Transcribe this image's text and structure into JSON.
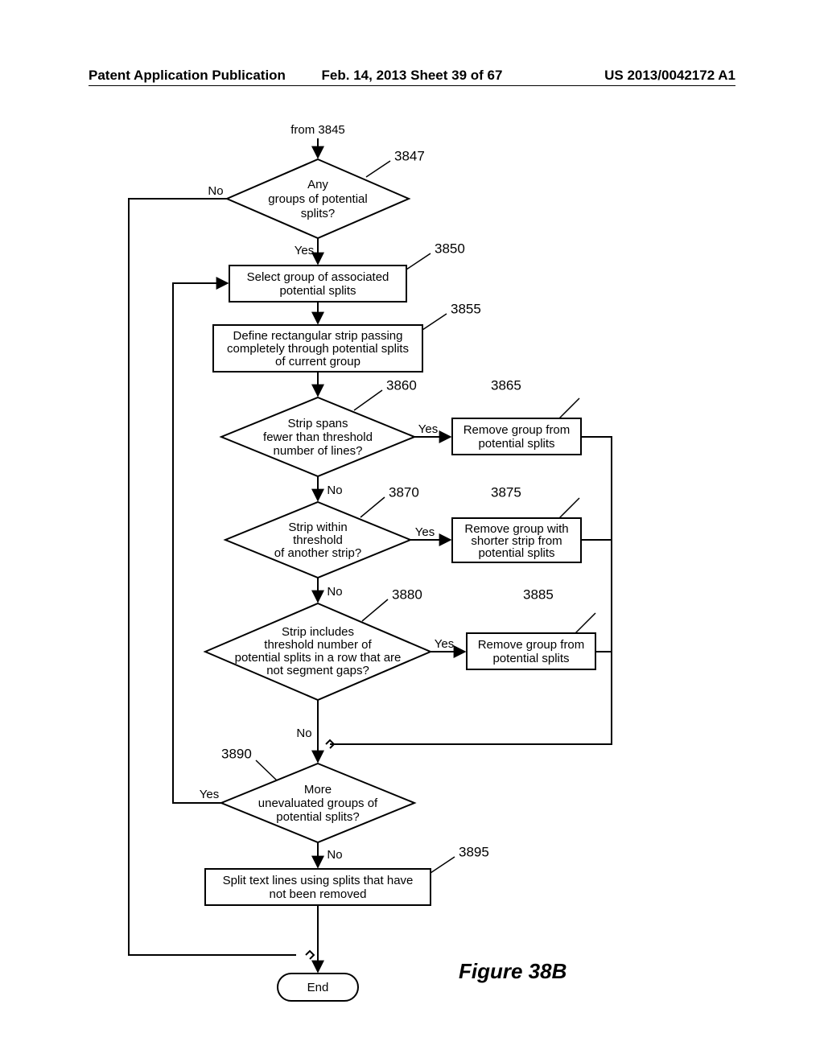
{
  "header": {
    "left": "Patent Application Publication",
    "center": "Feb. 14, 2013  Sheet 39 of 67",
    "right": "US 2013/0042172 A1"
  },
  "figure_title": "Figure 38B",
  "from_label": "from 3845",
  "refs": {
    "r3847": "3847",
    "r3850": "3850",
    "r3855": "3855",
    "r3860": "3860",
    "r3865": "3865",
    "r3870": "3870",
    "r3875": "3875",
    "r3880": "3880",
    "r3885": "3885",
    "r3890": "3890",
    "r3895": "3895"
  },
  "edges": {
    "yes": "Yes",
    "no": "No"
  },
  "nodes": {
    "d3847_l1": "Any",
    "d3847_l2": "groups of potential",
    "d3847_l3": "splits?",
    "b3850_l1": "Select group of associated",
    "b3850_l2": "potential splits",
    "b3855_l1": "Define rectangular strip passing",
    "b3855_l2": "completely through potential splits",
    "b3855_l3": "of current group",
    "d3860_l1": "Strip spans",
    "d3860_l2": "fewer than threshold",
    "d3860_l3": "number of lines?",
    "b3865_l1": "Remove group from",
    "b3865_l2": "potential splits",
    "d3870_l1": "Strip within",
    "d3870_l2": "threshold",
    "d3870_l3": "of another strip?",
    "b3875_l1": "Remove group with",
    "b3875_l2": "shorter strip from",
    "b3875_l3": "potential splits",
    "d3880_l1": "Strip includes",
    "d3880_l2": "threshold number of",
    "d3880_l3": "potential splits in a row that are",
    "d3880_l4": "not segment gaps?",
    "b3885_l1": "Remove group from",
    "b3885_l2": "potential splits",
    "d3890_l1": "More",
    "d3890_l2": "unevaluated groups of",
    "d3890_l3": "potential splits?",
    "b3895_l1": "Split text lines using splits that have",
    "b3895_l2": "not been removed",
    "end": "End"
  }
}
